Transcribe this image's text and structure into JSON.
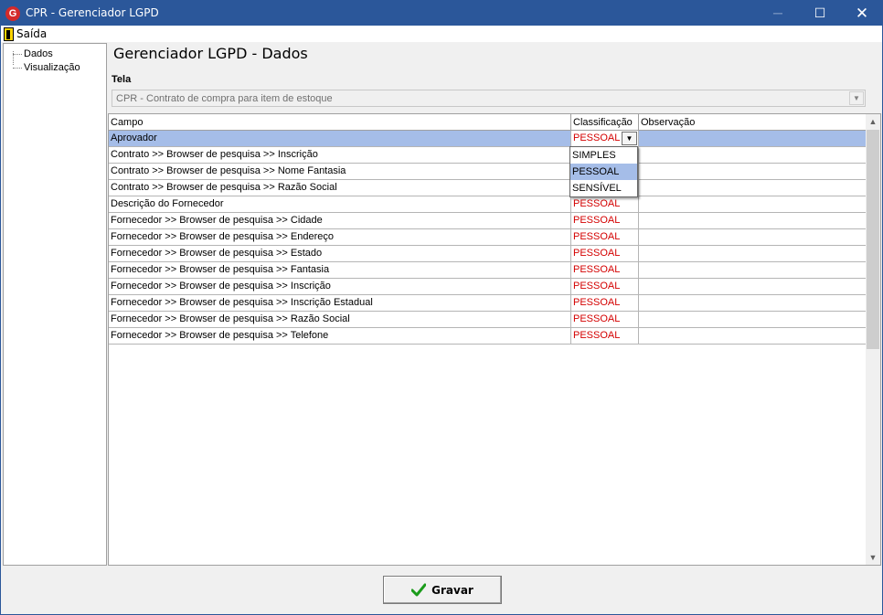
{
  "window": {
    "title": "CPR - Gerenciador LGPD",
    "app_icon": "G",
    "minimize_icon": "─",
    "maximize_icon": "☐",
    "close_icon": "✕"
  },
  "menu": {
    "exit_label": "Saída"
  },
  "tree": {
    "items": [
      {
        "label": "Dados"
      },
      {
        "label": "Visualização"
      }
    ]
  },
  "page": {
    "title": "Gerenciador LGPD - Dados",
    "tela_label": "Tela",
    "tela_value": "CPR - Contrato de compra para item de estoque"
  },
  "grid": {
    "headers": [
      "Campo",
      "Classificação",
      "Observação"
    ],
    "rows": [
      {
        "campo": "Aprovador",
        "classificacao": "PESSOAL",
        "observacao": ""
      },
      {
        "campo": "Contrato >> Browser de pesquisa >> Inscrição",
        "classificacao": "",
        "observacao": ""
      },
      {
        "campo": "Contrato >> Browser de pesquisa >> Nome Fantasia",
        "classificacao": "",
        "observacao": ""
      },
      {
        "campo": "Contrato >> Browser de pesquisa >> Razão Social",
        "classificacao": "",
        "observacao": ""
      },
      {
        "campo": "Descrição do Fornecedor",
        "classificacao": "PESSOAL",
        "observacao": ""
      },
      {
        "campo": "Fornecedor >> Browser de pesquisa >> Cidade",
        "classificacao": "PESSOAL",
        "observacao": ""
      },
      {
        "campo": "Fornecedor >> Browser de pesquisa >> Endereço",
        "classificacao": "PESSOAL",
        "observacao": ""
      },
      {
        "campo": "Fornecedor >> Browser de pesquisa >> Estado",
        "classificacao": "PESSOAL",
        "observacao": ""
      },
      {
        "campo": "Fornecedor >> Browser de pesquisa >> Fantasia",
        "classificacao": "PESSOAL",
        "observacao": ""
      },
      {
        "campo": "Fornecedor >> Browser de pesquisa >> Inscrição",
        "classificacao": "PESSOAL",
        "observacao": ""
      },
      {
        "campo": "Fornecedor >> Browser de pesquisa >> Inscrição Estadual",
        "classificacao": "PESSOAL",
        "observacao": ""
      },
      {
        "campo": "Fornecedor >> Browser de pesquisa >> Razão Social",
        "classificacao": "PESSOAL",
        "observacao": ""
      },
      {
        "campo": "Fornecedor >> Browser de pesquisa >> Telefone",
        "classificacao": "PESSOAL",
        "observacao": ""
      }
    ]
  },
  "dropdown": {
    "options": [
      "SIMPLES",
      "PESSOAL",
      "SENSÍVEL"
    ],
    "highlighted": "PESSOAL"
  },
  "footer": {
    "save_label": "Gravar"
  },
  "colors": {
    "titlebar": "#2b579a",
    "selection": "#a5bde8",
    "classification_text": "#d40000"
  }
}
